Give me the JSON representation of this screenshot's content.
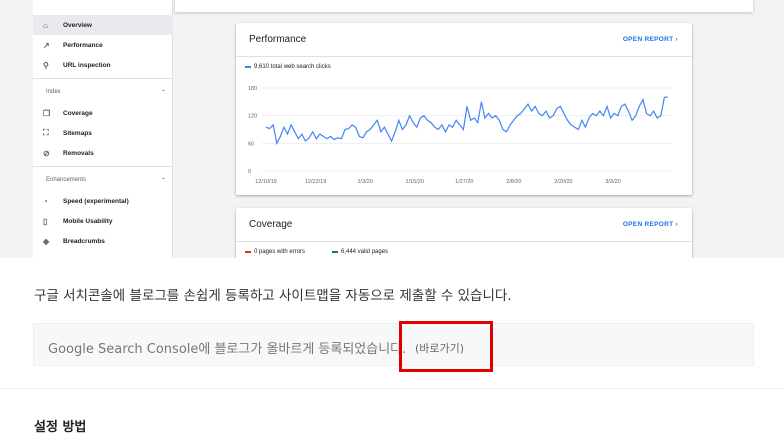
{
  "sidebar": {
    "items_top": [
      {
        "label": "Overview",
        "icon": "home-icon",
        "glyph": "⌂",
        "active": true
      },
      {
        "label": "Performance",
        "icon": "trending-icon",
        "glyph": "↗"
      },
      {
        "label": "URL inspection",
        "icon": "search-icon",
        "glyph": "⚲"
      }
    ],
    "index_label": "Index",
    "items_index": [
      {
        "label": "Coverage",
        "icon": "file-icon",
        "glyph": "❐"
      },
      {
        "label": "Sitemaps",
        "icon": "sitemap-icon",
        "glyph": "⛶"
      },
      {
        "label": "Removals",
        "icon": "removals-icon",
        "glyph": "⊘"
      }
    ],
    "enhancements_label": "Enhancements",
    "items_enh": [
      {
        "label": "Speed (experimental)",
        "icon": "speed-icon",
        "glyph": "◔"
      },
      {
        "label": "Mobile Usability",
        "icon": "phone-icon",
        "glyph": "▯"
      },
      {
        "label": "Breadcrumbs",
        "icon": "layers-icon",
        "glyph": "◈"
      }
    ],
    "chevron": "⌃"
  },
  "performance": {
    "title": "Performance",
    "open_report": "OPEN REPORT  ›",
    "legend": "9,610 total web search clicks",
    "series_color": "#4285f4"
  },
  "coverage": {
    "title": "Coverage",
    "open_report": "OPEN REPORT  ›",
    "legend_errors": "0 pages with errors",
    "legend_valid": "6,444 valid pages",
    "error_color": "#d93025",
    "valid_color": "#188038"
  },
  "chart_data": {
    "type": "line",
    "ylim": [
      0,
      180
    ],
    "yticks": [
      "180",
      "120",
      "60",
      "0"
    ],
    "xticks": [
      "12/10/19",
      "12/22/19",
      "1/3/20",
      "1/15/20",
      "1/27/20",
      "2/8/20",
      "2/20/20",
      "3/3/20"
    ],
    "series": [
      {
        "values": [
          95,
          92,
          100,
          60,
          75,
          95,
          80,
          100,
          85,
          70,
          80,
          65,
          72,
          85,
          70,
          80,
          75,
          70,
          75,
          68,
          72,
          70,
          90,
          92,
          100,
          95,
          75,
          72,
          85,
          90,
          100,
          110,
          85,
          95,
          80,
          65,
          85,
          110,
          90,
          100,
          120,
          105,
          95,
          115,
          120,
          110,
          105,
          95,
          90,
          100,
          85,
          100,
          95,
          110,
          100,
          90,
          140,
          110,
          115,
          105,
          150,
          115,
          125,
          115,
          120,
          110,
          90,
          85,
          100,
          110,
          120,
          125,
          135,
          145,
          130,
          140,
          125,
          120,
          130,
          115,
          120,
          135,
          140,
          125,
          110,
          100,
          95,
          90,
          110,
          95,
          115,
          125,
          120,
          130,
          120,
          140,
          115,
          125,
          120,
          140,
          145,
          130,
          110,
          120,
          140,
          155,
          125,
          120,
          130,
          115,
          120,
          160,
          160
        ]
      }
    ]
  },
  "page": {
    "description": "구글 서치콘솔에 블로그를 손쉽게 등록하고 사이트맵을 자동으로 제출할 수 있습니다.",
    "notice": "Google Search Console에 블로그가 올바르게 등록되었습니다.",
    "notice_link": "(바로가기)",
    "next_heading": "설정 방법",
    "highlight_color": "#e00000"
  }
}
